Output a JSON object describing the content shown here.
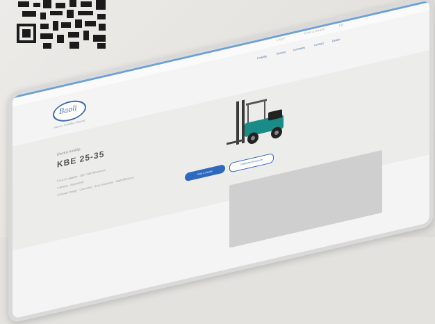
{
  "brand": {
    "logo_text": "Baoli"
  },
  "topbar_links": [
    "Login",
    "Find a Dealer",
    "EN"
  ],
  "nav": [
    "Forklifts",
    "Service",
    "Company",
    "Contact",
    "Dealer"
  ],
  "breadcrumb": "Home › Forklifts › Electric",
  "product": {
    "category": "Electric forklifts",
    "model": "KBE 25-35",
    "specs": [
      "2.5-3.5t capacity  ·  48V / 80V lithium-ion",
      "4 wheels  ·  Ergonomic",
      "Compact design · Low noise · Zero emissions · High efficiency"
    ],
    "primary_cta": "Find a Dealer",
    "secondary_cta": "Download Brochure"
  },
  "colors": {
    "accent": "#2f69bf",
    "teal": "#1a8c88",
    "topline": "#6ea0d8"
  }
}
